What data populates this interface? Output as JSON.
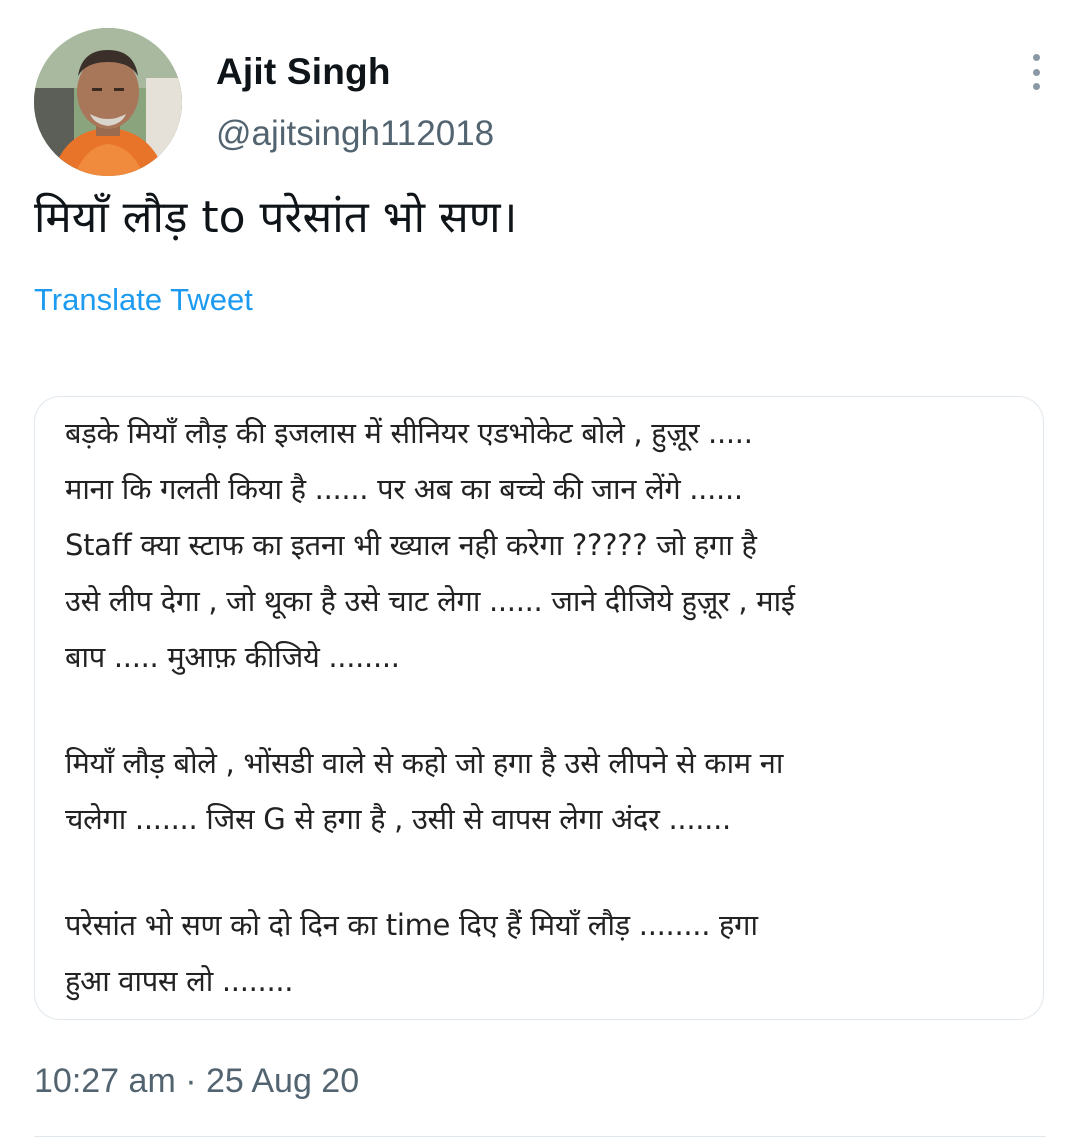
{
  "user": {
    "display_name": "Ajit Singh",
    "handle": "@ajitsingh112018",
    "avatar_icon": "user-avatar"
  },
  "more_icon": "more-vertical-icon",
  "tweet": {
    "text": "मियाँ लौड़ to परेसांत भो सण।",
    "translate_label": "Translate Tweet",
    "timestamp": "10:27 am · 25 Aug 20"
  },
  "media": {
    "paragraph1": [
      "बड़के मियाँ लौड़ की इजलास में सीनियर एडभोकेट बोले , हुज़ूर .....",
      "माना कि गलती किया है ...... पर अब का बच्चे की जान लेंगे ......",
      "Staff क्या स्टाफ का इतना भी ख्याल नही करेगा ????? जो हगा है",
      "उसे लीप देगा , जो थूका है उसे चाट लेगा ...... जाने दीजिये हुज़ूर , माई",
      "बाप ..... मुआफ़  कीजिये ........"
    ],
    "paragraph2": [
      "मियाँ लौड़ बोले , भोंसडी वाले से कहो जो हगा है उसे लीपने से काम ना",
      "चलेगा ....... जिस G से हगा है , उसी से वापस लेगा अंदर ......."
    ],
    "paragraph3": [
      "परेसांत भो सण को दो दिन का time दिए हैं मियाँ लौड़ ........ हगा",
      "हुआ वापस लो ........"
    ]
  },
  "colors": {
    "text_primary": "#0f1419",
    "text_secondary": "#536471",
    "link": "#1d9bf0",
    "border": "#e1e8ed"
  }
}
